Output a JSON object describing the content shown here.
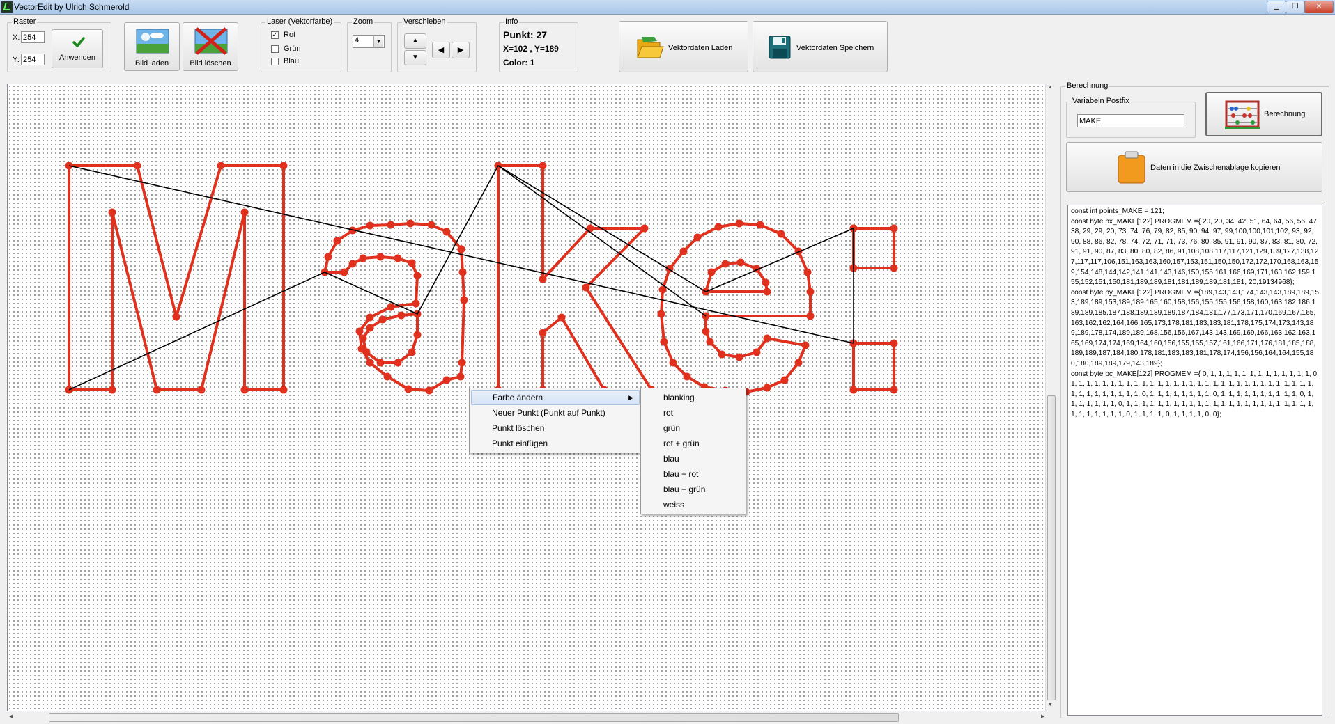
{
  "window": {
    "title": "VectorEdit by Ulrich Schmerold"
  },
  "raster": {
    "label": "Raster",
    "x_label": "X:",
    "x_value": "254",
    "y_label": "Y:",
    "y_value": "254",
    "apply_label": "Anwenden"
  },
  "toolbar": {
    "load_image_label": "Bild laden",
    "delete_image_label": "Bild löschen",
    "load_vector_label": "Vektordaten Laden",
    "save_vector_label": "Vektordaten Speichern"
  },
  "laser": {
    "label": "Laser (Vektorfarbe)",
    "options": [
      {
        "label": "Rot",
        "checked": true
      },
      {
        "label": "Grün",
        "checked": false
      },
      {
        "label": "Blau",
        "checked": false
      }
    ]
  },
  "zoom": {
    "label": "Zoom",
    "value": "4"
  },
  "move": {
    "label": "Verschieben"
  },
  "info": {
    "label": "Info",
    "point": "Punkt: 27",
    "coords": "X=102 , Y=189",
    "color": "Color: 1"
  },
  "calc": {
    "group_label": "Berechnung",
    "postfix_label": "Variabeln Postfix",
    "postfix_value": "MAKE",
    "calc_button_label": "Berechnung",
    "copy_button_label": "Daten in die Zwischenablage kopieren"
  },
  "code_output": [
    "const int points_MAKE = 121;",
    "const byte px_MAKE[122] PROGMEM ={ 20, 20, 34, 42, 51, 64, 64, 56, 56, 47, 38, 29, 29, 20, 73, 74, 76, 79, 82, 85, 90, 94, 97, 99,100,100,101,102, 93, 92, 90, 88, 86, 82, 78, 74, 72, 71, 71, 73, 76, 80, 85, 91, 91, 90, 87, 83, 81, 80, 72, 91, 91, 90, 87, 83, 80, 80, 82, 86, 91,108,108,117,117,121,129,139,127,138,127,117,117,106,151,163,163,160,157,153,151,150,150,172,172,170,168,163,159,154,148,144,142,141,141,143,146,150,155,161,166,169,171,163,162,159,155,152,151,150,181,189,189,181,181,189,189,181,181, 20,19134968};",
    "const byte py_MAKE[122] PROGMEM ={189,143,143,174,143,143,189,189,153,189,189,153,189,189,165,160,158,156,155,155,156,158,160,163,182,186,189,189,185,187,188,189,189,189,187,184,181,177,173,171,170,169,167,165,163,162,162,164,166,165,173,178,181,183,183,181,178,175,174,173,143,189,189,178,174,189,189,168,156,156,167,143,143,169,169,166,163,162,163,165,169,174,174,169,164,160,156,155,155,157,161,166,171,176,181,185,188,189,189,187,184,180,178,181,183,183,181,178,174,156,156,164,164,155,180,180,189,189,179,143,189};",
    "const byte pc_MAKE[122] PROGMEM ={ 0, 1, 1, 1, 1, 1, 1, 1, 1, 1, 1, 1, 1, 1, 0, 1, 1, 1, 1, 1, 1, 1, 1, 1, 1, 1, 1, 1, 1, 1, 1, 1, 1, 1, 1, 1, 1, 1, 1, 1, 1, 1, 1, 1, 1, 1, 1, 1, 1, 1, 1, 1, 1, 1, 1, 0, 1, 1, 1, 1, 1, 1, 1, 1, 0, 1, 1, 1, 1, 1, 1, 1, 1, 1, 1, 0, 1, 1, 1, 1, 1, 1, 1, 0, 1, 1, 1, 1, 1, 1, 1, 1, 1, 1, 1, 1, 1, 1, 1, 1, 1, 1, 1, 1, 1, 1, 1, 1, 1, 1, 1, 1, 1, 1, 1, 0, 1, 1, 1, 1, 0, 1, 1, 1, 1, 0, 0};"
  ],
  "context_menu": {
    "items": [
      {
        "label": "Farbe ändern",
        "submenu": true
      },
      {
        "label": "Neuer Punkt (Punkt auf Punkt)"
      },
      {
        "label": "Punkt löschen"
      },
      {
        "label": "Punkt einfügen"
      }
    ],
    "submenu": [
      "blanking",
      "rot",
      "grün",
      "rot + grün",
      "blau",
      "blau + rot",
      "blau + grün",
      "weiss"
    ]
  },
  "colors": {
    "path_red": "#e0301e",
    "blank_black": "#000000"
  },
  "icons": {
    "apply": "checkmark-icon",
    "load_image": "landscape-image-icon",
    "delete_image": "crossed-image-icon",
    "load_vector": "open-folder-icon",
    "save_vector": "floppy-disk-icon",
    "calc": "abacus-icon",
    "copy": "clipboard-icon"
  }
}
